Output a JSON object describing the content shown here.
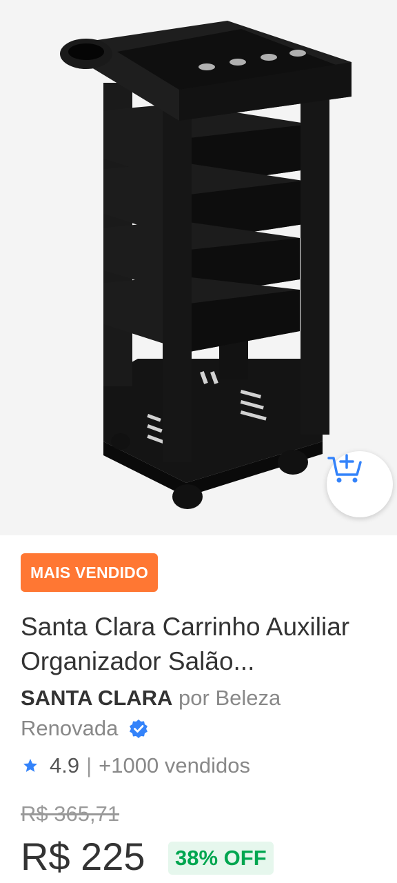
{
  "product": {
    "image_alt": "Carrinho auxiliar organizador preto",
    "badge": "MAIS VENDIDO",
    "title": "Santa Clara Carrinho Auxiliar Organizador Salão...",
    "brand": "SANTA CLARA",
    "seller_prefix": "por Beleza Renovada",
    "rating": "4.9",
    "rating_separator": "|",
    "sold": "+1000 vendidos",
    "old_price": "R$ 365,71",
    "price": "R$ 225",
    "discount": "38% OFF"
  },
  "icons": {
    "add_to_cart": "cart-plus-icon",
    "verified": "verified-check-icon",
    "star": "star-icon"
  },
  "colors": {
    "badge_bg": "#ff7733",
    "accent_blue": "#3483fa",
    "discount_green": "#00a650",
    "discount_bg": "#e6f7ed"
  }
}
